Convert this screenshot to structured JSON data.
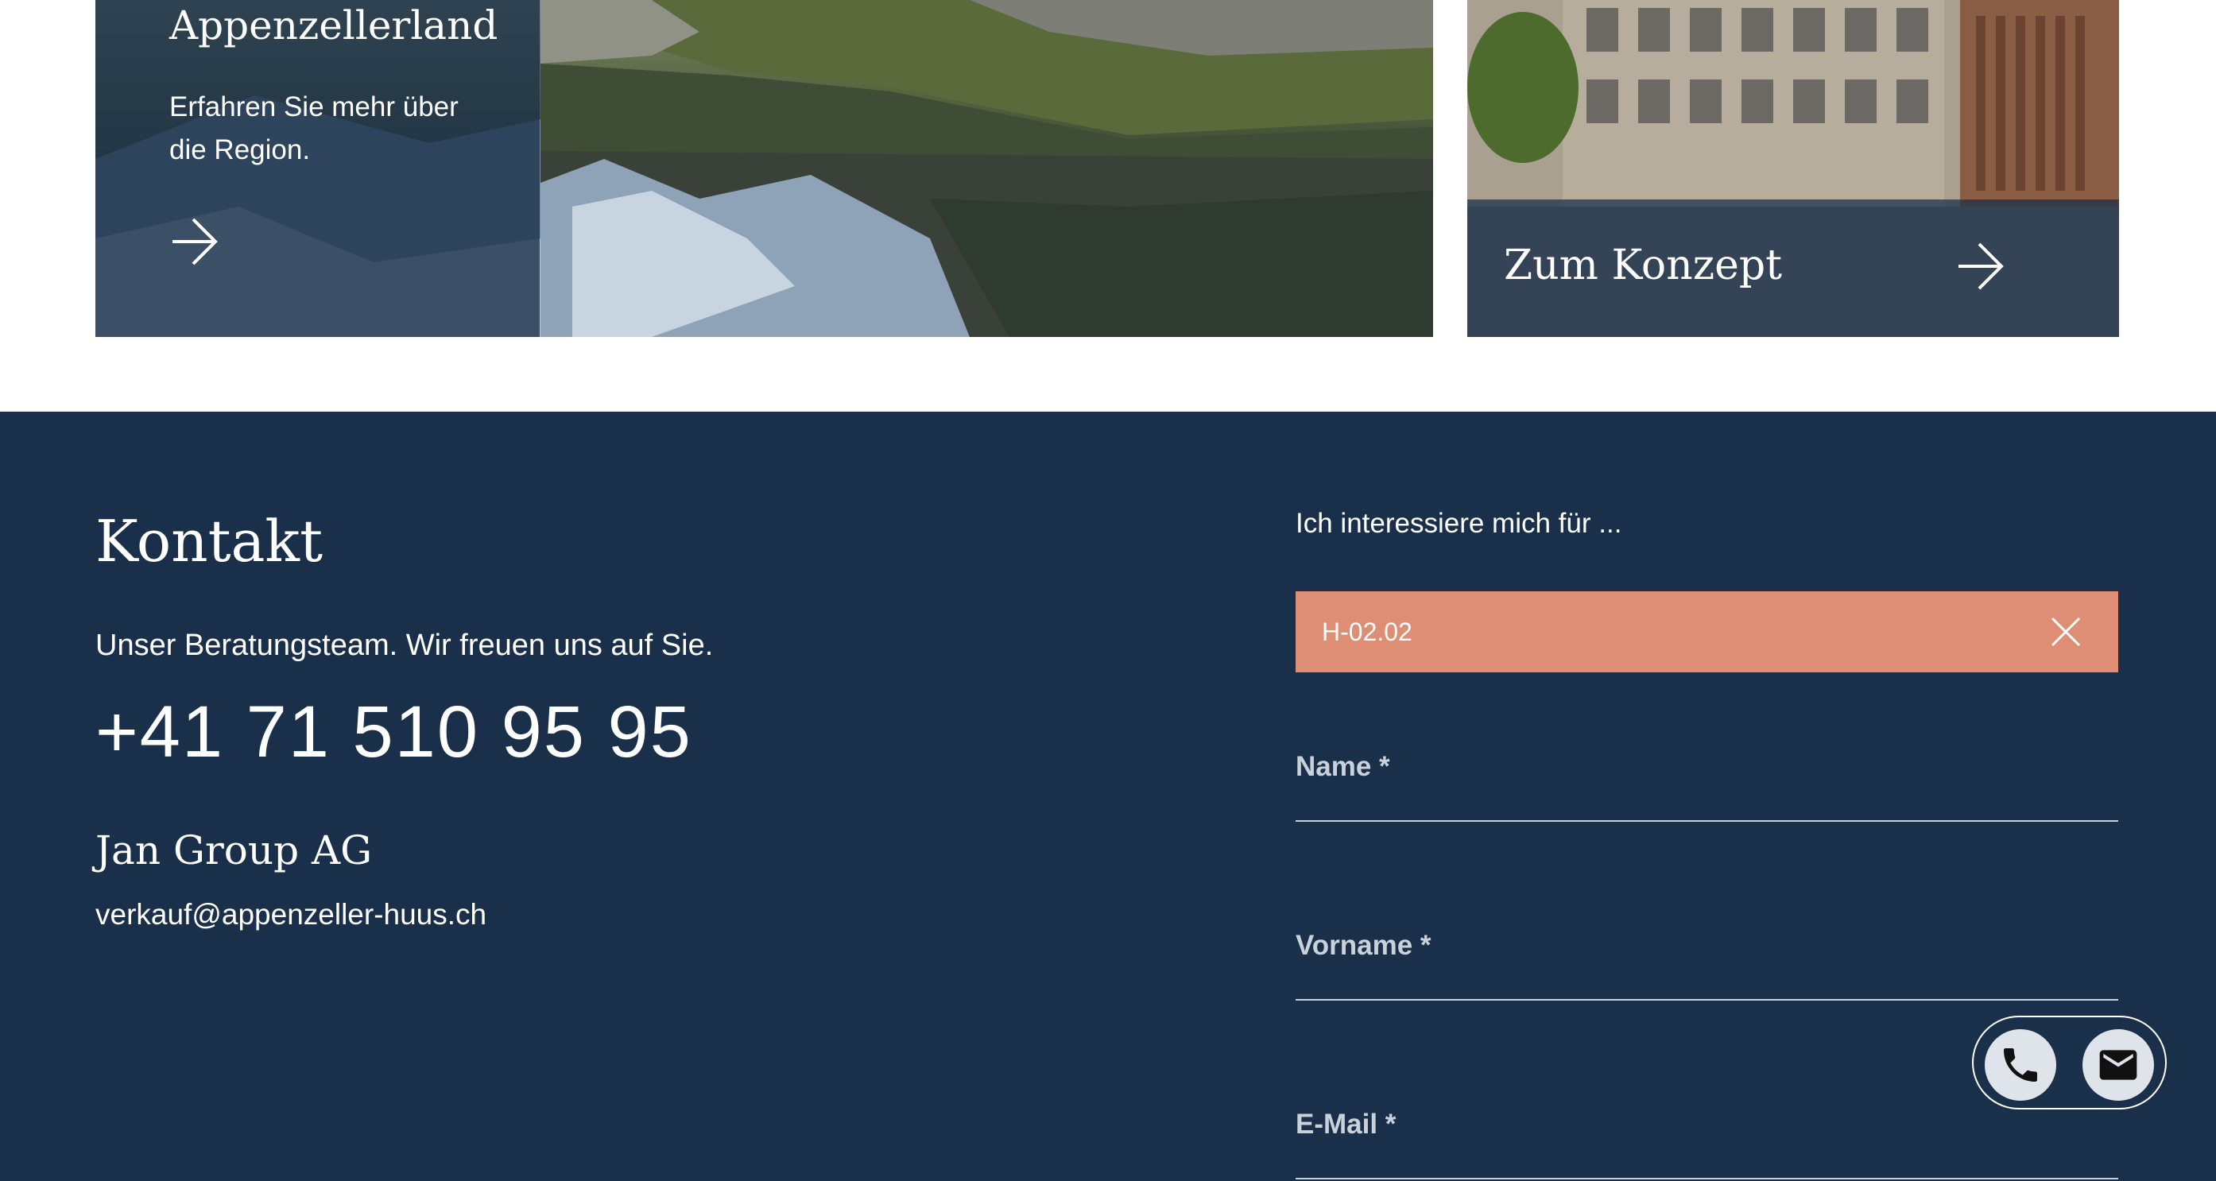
{
  "region_card": {
    "title": "Appenzellerland",
    "text": "Erfahren Sie mehr über die Region.",
    "arrow_icon": "arrow-right-icon"
  },
  "concept_card": {
    "title": "Zum Konzept",
    "arrow_icon": "arrow-right-icon"
  },
  "contact": {
    "heading": "Kontakt",
    "subtitle": "Unser Beratungsteam. Wir freuen uns auf Sie.",
    "phone": "+41 71 510 95 95",
    "company": "Jan Group AG",
    "email": "verkauf@appenzeller-huus.ch"
  },
  "form": {
    "interest_label": "Ich interessiere mich für ...",
    "selected_unit": "H-02.02",
    "remove_icon": "close-icon",
    "fields": {
      "name_label": "Name *",
      "vorname_label": "Vorname *",
      "email_label": "E-Mail *"
    }
  },
  "floating_actions": {
    "phone_icon": "phone-icon",
    "mail_icon": "mail-icon"
  },
  "colors": {
    "navy": "#1a304a",
    "chip": "#de8e74",
    "text": "#ffffff",
    "label": "#c9d1db"
  }
}
